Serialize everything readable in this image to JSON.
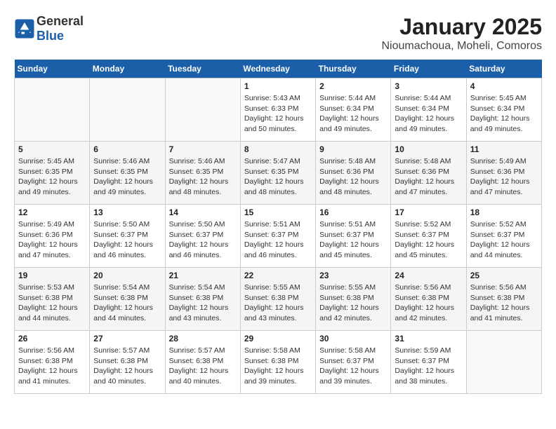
{
  "header": {
    "logo_general": "General",
    "logo_blue": "Blue",
    "month": "January 2025",
    "location": "Nioumachoua, Moheli, Comoros"
  },
  "weekdays": [
    "Sunday",
    "Monday",
    "Tuesday",
    "Wednesday",
    "Thursday",
    "Friday",
    "Saturday"
  ],
  "weeks": [
    [
      {
        "day": "",
        "info": ""
      },
      {
        "day": "",
        "info": ""
      },
      {
        "day": "",
        "info": ""
      },
      {
        "day": "1",
        "info": "Sunrise: 5:43 AM\nSunset: 6:33 PM\nDaylight: 12 hours\nand 50 minutes."
      },
      {
        "day": "2",
        "info": "Sunrise: 5:44 AM\nSunset: 6:34 PM\nDaylight: 12 hours\nand 49 minutes."
      },
      {
        "day": "3",
        "info": "Sunrise: 5:44 AM\nSunset: 6:34 PM\nDaylight: 12 hours\nand 49 minutes."
      },
      {
        "day": "4",
        "info": "Sunrise: 5:45 AM\nSunset: 6:34 PM\nDaylight: 12 hours\nand 49 minutes."
      }
    ],
    [
      {
        "day": "5",
        "info": "Sunrise: 5:45 AM\nSunset: 6:35 PM\nDaylight: 12 hours\nand 49 minutes."
      },
      {
        "day": "6",
        "info": "Sunrise: 5:46 AM\nSunset: 6:35 PM\nDaylight: 12 hours\nand 49 minutes."
      },
      {
        "day": "7",
        "info": "Sunrise: 5:46 AM\nSunset: 6:35 PM\nDaylight: 12 hours\nand 48 minutes."
      },
      {
        "day": "8",
        "info": "Sunrise: 5:47 AM\nSunset: 6:35 PM\nDaylight: 12 hours\nand 48 minutes."
      },
      {
        "day": "9",
        "info": "Sunrise: 5:48 AM\nSunset: 6:36 PM\nDaylight: 12 hours\nand 48 minutes."
      },
      {
        "day": "10",
        "info": "Sunrise: 5:48 AM\nSunset: 6:36 PM\nDaylight: 12 hours\nand 47 minutes."
      },
      {
        "day": "11",
        "info": "Sunrise: 5:49 AM\nSunset: 6:36 PM\nDaylight: 12 hours\nand 47 minutes."
      }
    ],
    [
      {
        "day": "12",
        "info": "Sunrise: 5:49 AM\nSunset: 6:36 PM\nDaylight: 12 hours\nand 47 minutes."
      },
      {
        "day": "13",
        "info": "Sunrise: 5:50 AM\nSunset: 6:37 PM\nDaylight: 12 hours\nand 46 minutes."
      },
      {
        "day": "14",
        "info": "Sunrise: 5:50 AM\nSunset: 6:37 PM\nDaylight: 12 hours\nand 46 minutes."
      },
      {
        "day": "15",
        "info": "Sunrise: 5:51 AM\nSunset: 6:37 PM\nDaylight: 12 hours\nand 46 minutes."
      },
      {
        "day": "16",
        "info": "Sunrise: 5:51 AM\nSunset: 6:37 PM\nDaylight: 12 hours\nand 45 minutes."
      },
      {
        "day": "17",
        "info": "Sunrise: 5:52 AM\nSunset: 6:37 PM\nDaylight: 12 hours\nand 45 minutes."
      },
      {
        "day": "18",
        "info": "Sunrise: 5:52 AM\nSunset: 6:37 PM\nDaylight: 12 hours\nand 44 minutes."
      }
    ],
    [
      {
        "day": "19",
        "info": "Sunrise: 5:53 AM\nSunset: 6:38 PM\nDaylight: 12 hours\nand 44 minutes."
      },
      {
        "day": "20",
        "info": "Sunrise: 5:54 AM\nSunset: 6:38 PM\nDaylight: 12 hours\nand 44 minutes."
      },
      {
        "day": "21",
        "info": "Sunrise: 5:54 AM\nSunset: 6:38 PM\nDaylight: 12 hours\nand 43 minutes."
      },
      {
        "day": "22",
        "info": "Sunrise: 5:55 AM\nSunset: 6:38 PM\nDaylight: 12 hours\nand 43 minutes."
      },
      {
        "day": "23",
        "info": "Sunrise: 5:55 AM\nSunset: 6:38 PM\nDaylight: 12 hours\nand 42 minutes."
      },
      {
        "day": "24",
        "info": "Sunrise: 5:56 AM\nSunset: 6:38 PM\nDaylight: 12 hours\nand 42 minutes."
      },
      {
        "day": "25",
        "info": "Sunrise: 5:56 AM\nSunset: 6:38 PM\nDaylight: 12 hours\nand 41 minutes."
      }
    ],
    [
      {
        "day": "26",
        "info": "Sunrise: 5:56 AM\nSunset: 6:38 PM\nDaylight: 12 hours\nand 41 minutes."
      },
      {
        "day": "27",
        "info": "Sunrise: 5:57 AM\nSunset: 6:38 PM\nDaylight: 12 hours\nand 40 minutes."
      },
      {
        "day": "28",
        "info": "Sunrise: 5:57 AM\nSunset: 6:38 PM\nDaylight: 12 hours\nand 40 minutes."
      },
      {
        "day": "29",
        "info": "Sunrise: 5:58 AM\nSunset: 6:38 PM\nDaylight: 12 hours\nand 39 minutes."
      },
      {
        "day": "30",
        "info": "Sunrise: 5:58 AM\nSunset: 6:37 PM\nDaylight: 12 hours\nand 39 minutes."
      },
      {
        "day": "31",
        "info": "Sunrise: 5:59 AM\nSunset: 6:37 PM\nDaylight: 12 hours\nand 38 minutes."
      },
      {
        "day": "",
        "info": ""
      }
    ]
  ]
}
